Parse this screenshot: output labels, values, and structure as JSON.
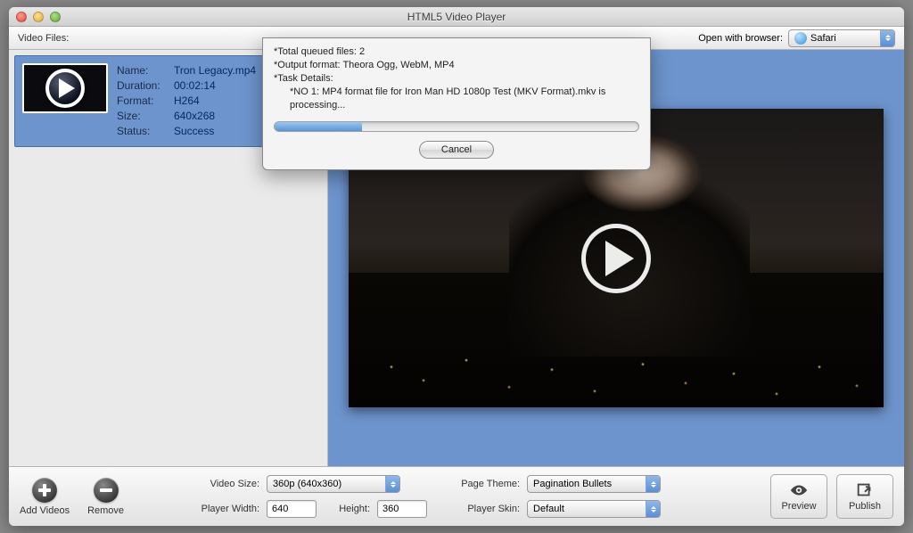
{
  "window": {
    "title": "HTML5 Video Player"
  },
  "topbar": {
    "video_files_label": "Video Files:",
    "open_with_browser_label": "Open with browser:",
    "browser_selected": "Safari"
  },
  "file": {
    "labels": {
      "name": "Name:",
      "duration": "Duration:",
      "format": "Format:",
      "size": "Size:",
      "status": "Status:"
    },
    "name": "Tron Legacy.mp4",
    "duration": "00:02:14",
    "format": "H264",
    "size": "640x268",
    "status": "Success"
  },
  "dialog": {
    "line1": "*Total queued files: 2",
    "line2": "*Output format: Theora Ogg, WebM, MP4",
    "line3": "*Task Details:",
    "line4": "*NO 1: MP4 format file for Iron Man HD 1080p Test (MKV Format).mkv is processing...",
    "cancel_label": "Cancel"
  },
  "bottom": {
    "add_videos_label": "Add Videos",
    "remove_label": "Remove",
    "video_size_label": "Video Size:",
    "video_size_value": "360p (640x360)",
    "player_width_label": "Player Width:",
    "player_width_value": "640",
    "height_label": "Height:",
    "height_value": "360",
    "page_theme_label": "Page Theme:",
    "page_theme_value": "Pagination Bullets",
    "player_skin_label": "Player Skin:",
    "player_skin_value": "Default",
    "preview_label": "Preview",
    "publish_label": "Publish"
  }
}
